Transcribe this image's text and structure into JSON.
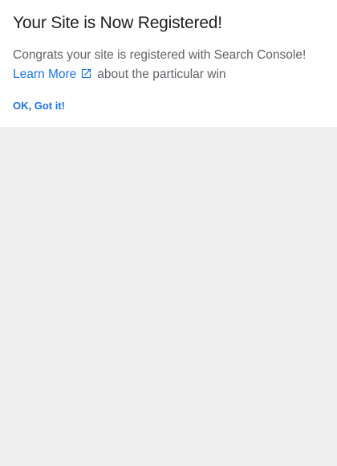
{
  "dialog": {
    "title": "Your Site is Now Registered!",
    "message": "Congrats your site is registered with Search Console!",
    "learn_more_label": "Learn More",
    "learn_more_suffix": "about the particular win",
    "ok_label": "OK, Got it!",
    "external_link_icon": "external-link-icon"
  },
  "colors": {
    "link": "#1a73e8",
    "title": "#202124",
    "body_text": "#5f6368",
    "background": "#efefef",
    "card": "#ffffff"
  }
}
